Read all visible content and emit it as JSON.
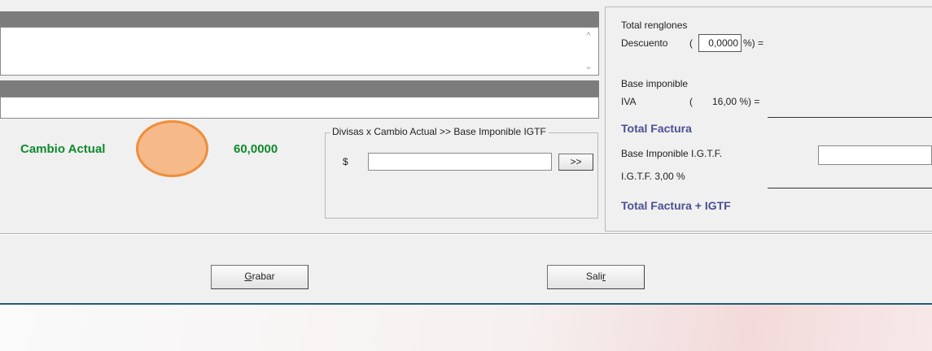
{
  "top_panel": {
    "scroll_up": "^",
    "scroll_down": "⌄"
  },
  "exchange": {
    "label": "Cambio Actual",
    "value": "60,0000",
    "indicator_color": "#f5b98a",
    "indicator_border": "#ef8e3b"
  },
  "divisas_group": {
    "legend": "Divisas x Cambio Actual >> Base Imponible IGTF",
    "currency_symbol": "$",
    "amount_value": "",
    "transfer_button": ">>"
  },
  "totals": {
    "total_renglones_label": "Total renglones",
    "descuento_label": "Descuento",
    "descuento_open": "(",
    "descuento_value": "0,0000",
    "descuento_suffix": "%) =",
    "base_imponible_label": "Base imponible",
    "iva_label": "IVA",
    "iva_open": "(",
    "iva_value": "16,00 %) =",
    "total_factura_label": "Total Factura",
    "base_igtf_label": "Base Imponible I.G.T.F.",
    "base_igtf_value": "",
    "igtf_label": "I.G.T.F. 3,00 %",
    "total_igtf_label": "Total Factura + IGTF"
  },
  "actions": {
    "save_prefix": "G",
    "save_rest": "rabar",
    "exit_prefix": "Sali",
    "exit_underlined": "r"
  },
  "colors": {
    "accent_blue": "#4a4f95",
    "accent_green": "#0e8a2c",
    "divider": "#1f5d7a"
  }
}
